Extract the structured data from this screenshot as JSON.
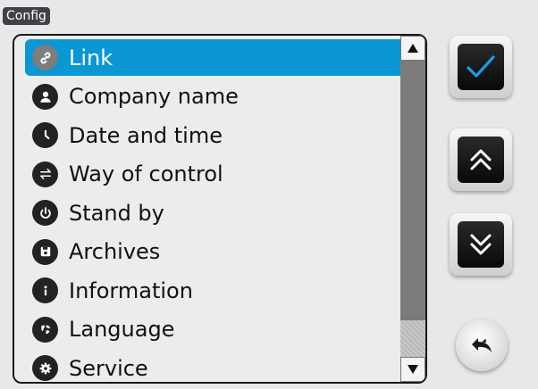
{
  "window": {
    "title": "Config"
  },
  "menu": {
    "items": [
      {
        "label": "Link",
        "icon": "link-icon",
        "selected": true
      },
      {
        "label": "Company name",
        "icon": "user-icon",
        "selected": false
      },
      {
        "label": "Date and time",
        "icon": "clock-icon",
        "selected": false
      },
      {
        "label": "Way of control",
        "icon": "swap-arrows-icon",
        "selected": false
      },
      {
        "label": "Stand by",
        "icon": "power-icon",
        "selected": false
      },
      {
        "label": "Archives",
        "icon": "save-icon",
        "selected": false
      },
      {
        "label": "Information",
        "icon": "info-icon",
        "selected": false
      },
      {
        "label": "Language",
        "icon": "globe-icon",
        "selected": false
      },
      {
        "label": "Service",
        "icon": "gear-icon",
        "selected": false
      }
    ]
  },
  "colors": {
    "selected_bg": "#0a97d4",
    "check_color": "#1e9be0",
    "background": "#e8e8e8"
  },
  "side_buttons": {
    "confirm": "check-icon",
    "page_up": "double-chevron-up-icon",
    "page_down": "double-chevron-down-icon",
    "back": "back-arrow-icon"
  }
}
